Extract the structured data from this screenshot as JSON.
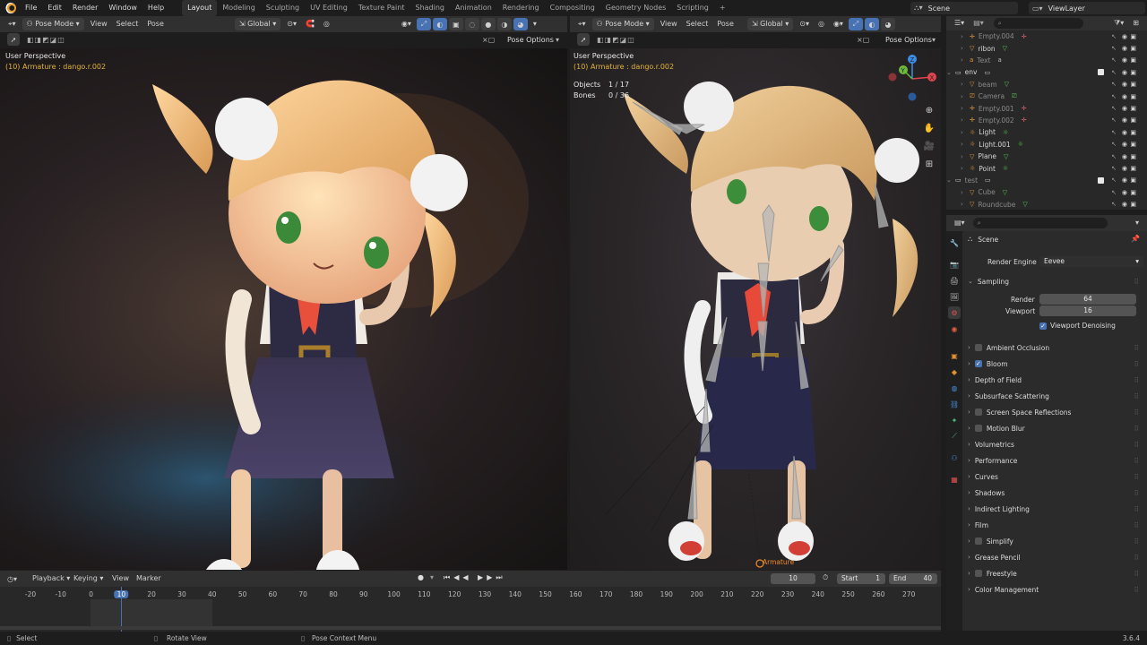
{
  "menu": [
    "File",
    "Edit",
    "Render",
    "Window",
    "Help"
  ],
  "workspaces": [
    "Layout",
    "Modeling",
    "Sculpting",
    "UV Editing",
    "Texture Paint",
    "Shading",
    "Animation",
    "Rendering",
    "Compositing",
    "Geometry Nodes",
    "Scripting"
  ],
  "active_workspace": "Layout",
  "add_tab": "+",
  "scene": "Scene",
  "view_layer": "ViewLayer",
  "viewport_left": {
    "mode": "Pose Mode",
    "menus": [
      "View",
      "Select",
      "Pose"
    ],
    "orientation": "Global",
    "pose_options": "Pose Options",
    "perspective": "User Perspective",
    "object_info": "(10) Armature : dango.r.002"
  },
  "viewport_right": {
    "mode": "Pose Mode",
    "menus": [
      "View",
      "Select",
      "Pose"
    ],
    "orientation": "Global",
    "pose_options": "Pose Options",
    "perspective": "User Perspective",
    "object_info": "(10) Armature : dango.r.002",
    "stats": [
      {
        "label": "Objects",
        "value": "1 / 17"
      },
      {
        "label": "Bones",
        "value": "0 / 36"
      }
    ],
    "armature_label": "Armature"
  },
  "outliner": {
    "rows": [
      {
        "name": "Empty.004",
        "type": "empty",
        "dim": true,
        "indent": 2
      },
      {
        "name": "ribon",
        "type": "mesh",
        "dim": false,
        "indent": 2
      },
      {
        "name": "Text",
        "type": "text",
        "dim": true,
        "indent": 2
      },
      {
        "name": "env",
        "type": "collection",
        "dim": false,
        "indent": 1
      },
      {
        "name": "beam",
        "type": "mesh",
        "dim": true,
        "indent": 2
      },
      {
        "name": "Camera",
        "type": "camera",
        "dim": true,
        "indent": 2
      },
      {
        "name": "Empty.001",
        "type": "empty",
        "dim": true,
        "indent": 2
      },
      {
        "name": "Empty.002",
        "type": "empty",
        "dim": true,
        "indent": 2
      },
      {
        "name": "Light",
        "type": "light",
        "dim": false,
        "indent": 2
      },
      {
        "name": "Light.001",
        "type": "light",
        "dim": false,
        "indent": 2
      },
      {
        "name": "Plane",
        "type": "mesh",
        "dim": false,
        "indent": 2
      },
      {
        "name": "Point",
        "type": "light",
        "dim": false,
        "indent": 2
      },
      {
        "name": "test",
        "type": "collection",
        "dim": true,
        "indent": 1
      },
      {
        "name": "Cube",
        "type": "mesh",
        "dim": true,
        "indent": 2
      },
      {
        "name": "Roundcube",
        "type": "mesh",
        "dim": true,
        "indent": 2
      }
    ]
  },
  "properties": {
    "context": "Scene",
    "render_engine_label": "Render Engine",
    "render_engine": "Eevee",
    "sampling": "Sampling",
    "render_label": "Render",
    "render_samples": "64",
    "viewport_label": "Viewport",
    "viewport_samples": "16",
    "viewport_denoising": "Viewport Denoising",
    "sections": [
      {
        "label": "Ambient Occlusion",
        "checkbox": true,
        "checked": false
      },
      {
        "label": "Bloom",
        "checkbox": true,
        "checked": true
      },
      {
        "label": "Depth of Field",
        "checkbox": false
      },
      {
        "label": "Subsurface Scattering",
        "checkbox": false
      },
      {
        "label": "Screen Space Reflections",
        "checkbox": true,
        "checked": false
      },
      {
        "label": "Motion Blur",
        "checkbox": true,
        "checked": false
      },
      {
        "label": "Volumetrics",
        "checkbox": false
      },
      {
        "label": "Performance",
        "checkbox": false
      },
      {
        "label": "Curves",
        "checkbox": false
      },
      {
        "label": "Shadows",
        "checkbox": false
      },
      {
        "label": "Indirect Lighting",
        "checkbox": false
      },
      {
        "label": "Film",
        "checkbox": false
      },
      {
        "label": "Simplify",
        "checkbox": true,
        "checked": false
      },
      {
        "label": "Grease Pencil",
        "checkbox": false
      },
      {
        "label": "Freestyle",
        "checkbox": true,
        "checked": false
      },
      {
        "label": "Color Management",
        "checkbox": false
      }
    ]
  },
  "timeline": {
    "menus": [
      "Playback",
      "Keying",
      "View",
      "Marker"
    ],
    "current_frame": "10",
    "start_label": "Start",
    "start": "1",
    "end_label": "End",
    "end": "40",
    "ticks": [
      "-20",
      "-10",
      "0",
      "10",
      "20",
      "30",
      "40",
      "50",
      "60",
      "70",
      "80",
      "90",
      "100",
      "110",
      "120",
      "130",
      "140",
      "150",
      "160",
      "170",
      "180",
      "190",
      "200",
      "210",
      "220",
      "230",
      "240",
      "250",
      "260",
      "270"
    ]
  },
  "status_bar": {
    "select": "Select",
    "rotate": "Rotate View",
    "context": "Pose Context Menu",
    "version": "3.6.4"
  },
  "colors": {
    "accent": "#4772b3",
    "header": "#303030",
    "panel": "#2b2b2b",
    "highlight_text": "#e2b43a"
  }
}
